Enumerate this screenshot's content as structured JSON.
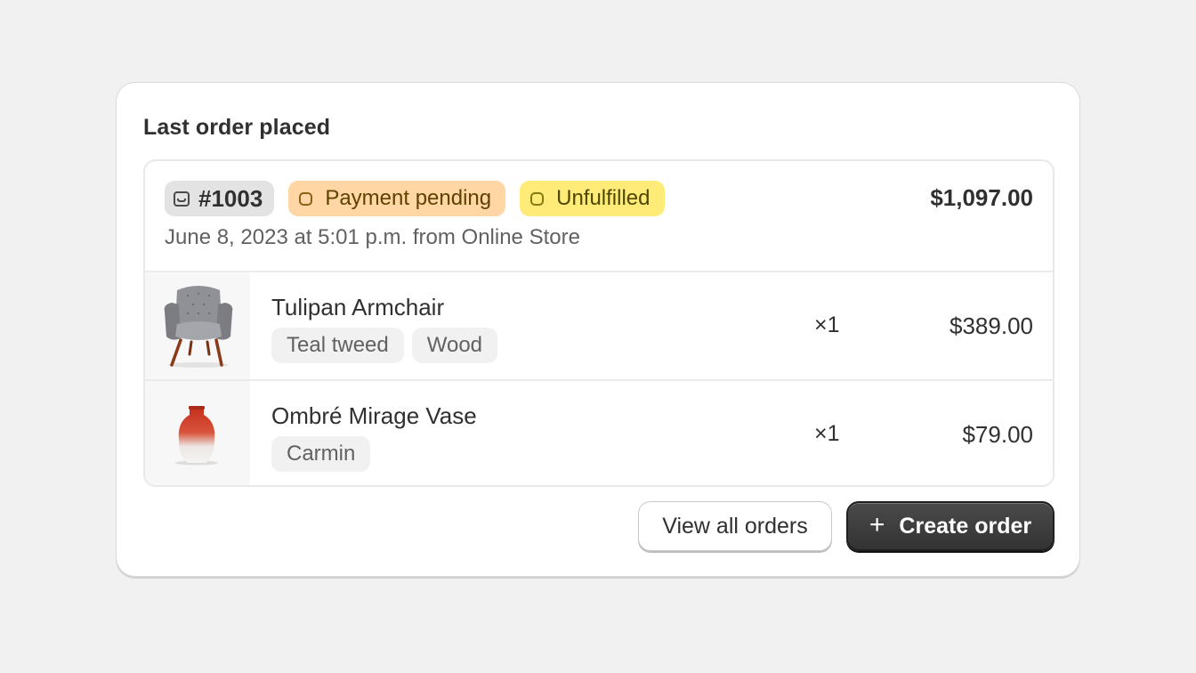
{
  "card": {
    "title": "Last order placed"
  },
  "order": {
    "number": "#1003",
    "payment_status": "Payment pending",
    "fulfillment_status": "Unfulfilled",
    "total": "$1,097.00",
    "meta": "June 8, 2023 at 5:01 p.m. from Online Store",
    "items": [
      {
        "name": "Tulipan Armchair",
        "tags": [
          "Teal tweed",
          "Wood"
        ],
        "quantity": "×1",
        "price": "$389.00",
        "image_icon": "armchair-image"
      },
      {
        "name": "Ombré Mirage Vase",
        "tags": [
          "Carmin"
        ],
        "quantity": "×1",
        "price": "$79.00",
        "image_icon": "vase-image"
      }
    ]
  },
  "actions": {
    "view_all_label": "View all orders",
    "create_label": "Create order",
    "create_icon": "plus-icon"
  },
  "colors": {
    "background": "#f1f1f1",
    "payment_badge": "#ffd6a4",
    "unfulfilled_badge": "#ffeb78",
    "primary_button": "#303030"
  }
}
